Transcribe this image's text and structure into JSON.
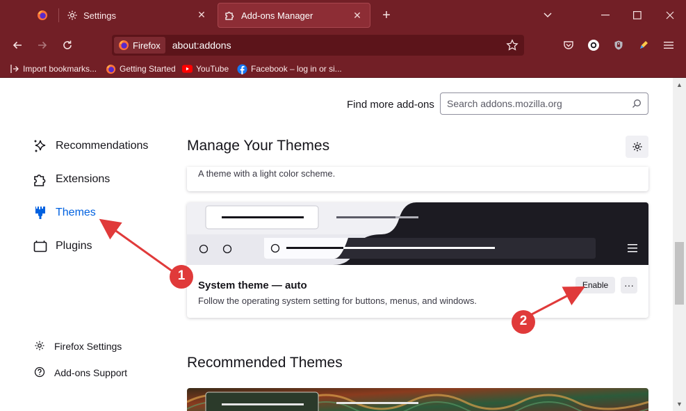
{
  "tabs": [
    {
      "label": ""
    },
    {
      "label": "Settings"
    },
    {
      "label": "Add-ons Manager"
    }
  ],
  "window_controls": {
    "list": "⌄",
    "minimize": "—",
    "maximize": "☐",
    "close": "✕"
  },
  "urlbar": {
    "identity": "Firefox",
    "url": "about:addons"
  },
  "bookmarks": [
    {
      "label": "Import bookmarks..."
    },
    {
      "label": "Getting Started"
    },
    {
      "label": "YouTube"
    },
    {
      "label": "Facebook – log in or si..."
    }
  ],
  "search": {
    "label": "Find more add-ons",
    "placeholder": "Search addons.mozilla.org"
  },
  "sidebar": {
    "items": [
      {
        "label": "Recommendations",
        "icon": "sparkle-icon"
      },
      {
        "label": "Extensions",
        "icon": "puzzle-icon"
      },
      {
        "label": "Themes",
        "icon": "brush-icon",
        "active": true
      },
      {
        "label": "Plugins",
        "icon": "plug-icon"
      }
    ],
    "footer": [
      {
        "label": "Firefox Settings",
        "icon": "gear-icon"
      },
      {
        "label": "Add-ons Support",
        "icon": "help-icon"
      }
    ]
  },
  "main": {
    "heading": "Manage Your Themes",
    "light_theme_desc": "A theme with a light color scheme.",
    "system_theme": {
      "name": "System theme — auto",
      "description": "Follow the operating system setting for buttons, menus, and windows.",
      "enable_label": "Enable",
      "more_label": "···"
    },
    "recommended_heading": "Recommended Themes"
  },
  "annotations": {
    "marker1": "1",
    "marker2": "2",
    "color": "#e03a3a"
  },
  "colors": {
    "chrome": "#721f26",
    "accent": "#0061e0"
  }
}
